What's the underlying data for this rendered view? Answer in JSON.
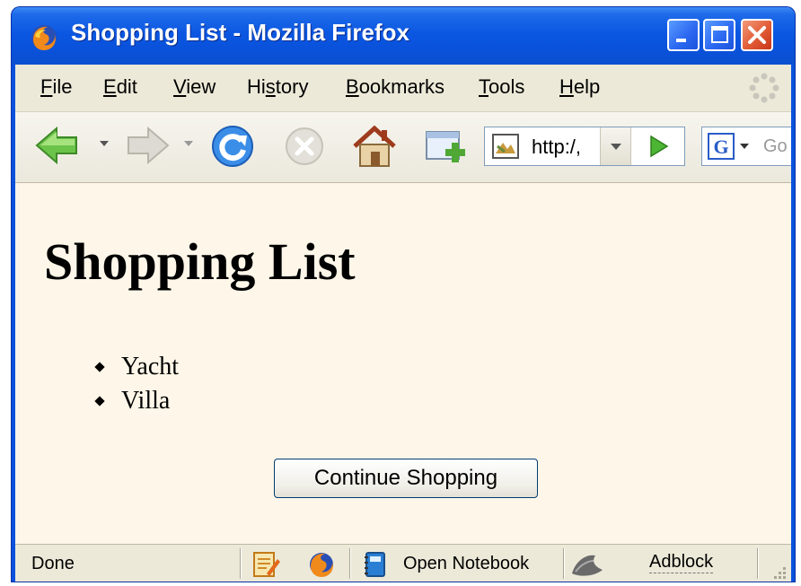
{
  "window": {
    "title": "Shopping List - Mozilla Firefox"
  },
  "menu": {
    "items": [
      {
        "label": "File",
        "accel": "F"
      },
      {
        "label": "Edit",
        "accel": "E"
      },
      {
        "label": "View",
        "accel": "V"
      },
      {
        "label": "History",
        "accel": "s"
      },
      {
        "label": "Bookmarks",
        "accel": "B"
      },
      {
        "label": "Tools",
        "accel": "T"
      },
      {
        "label": "Help",
        "accel": "H"
      }
    ]
  },
  "toolbar": {
    "url": "http:/,",
    "search_placeholder": "Go"
  },
  "page": {
    "heading": "Shopping List",
    "items": [
      "Yacht",
      "Villa"
    ],
    "continue_button": "Continue Shopping"
  },
  "status": {
    "text": "Done",
    "notebook_label": "Open Notebook",
    "adblock_label": "Adblock"
  },
  "colors": {
    "titlebar": "#0a52dc",
    "content_bg": "#fef7e9",
    "chrome_bg": "#ece9d8"
  }
}
